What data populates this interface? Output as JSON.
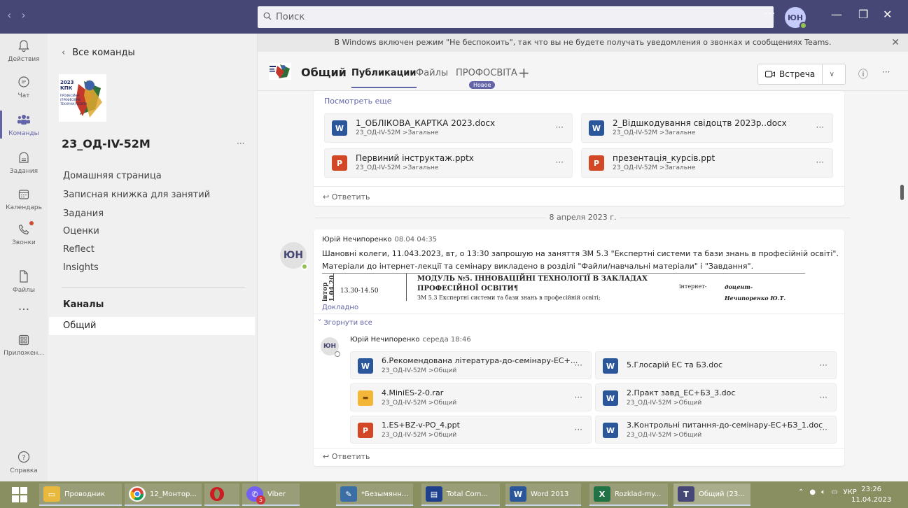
{
  "titlebar": {
    "back": "‹",
    "forward": "›",
    "search_placeholder": "Поиск",
    "more": "···",
    "avatar_initials": "ЮН",
    "minimize": "—",
    "restore": "❐",
    "close": "✕"
  },
  "rail": [
    {
      "label": "Действия",
      "icon": "bell-icon"
    },
    {
      "label": "Чат",
      "icon": "chat-icon"
    },
    {
      "label": "Команды",
      "icon": "teams-icon"
    },
    {
      "label": "Задания",
      "icon": "assignments-icon"
    },
    {
      "label": "Календарь",
      "icon": "calendar-icon"
    },
    {
      "label": "Звонки",
      "icon": "phone-icon"
    },
    {
      "label": "Файлы",
      "icon": "file-icon"
    },
    {
      "label": "···",
      "icon": "more-icon"
    },
    {
      "label": "Приложен...",
      "icon": "apps-icon"
    },
    {
      "label": "Справка",
      "icon": "help-icon"
    }
  ],
  "sidebar": {
    "back_label": "Все команды",
    "team_name": "23_ОД-IV-52M",
    "more": "···",
    "links": [
      "Домашняя страница",
      "Записная книжка для занятий",
      "Задания",
      "Оценки",
      "Reflect",
      "Insights"
    ],
    "channels_heading": "Каналы",
    "channels": [
      "Общий"
    ],
    "logo_text": "2023 КПК ПРОФЕСІЙНА (ПРОФЕСІЙНО ТЕХНІЧНА) ОСВІТА"
  },
  "main": {
    "dnd_notice": "В Windows включен режим \"Не беспокоить\", так что вы не будете получать уведомления о звонках и сообщениях Teams.",
    "channel_title": "Общий",
    "tabs": [
      "Публикации",
      "Файлы",
      "ПРОФОСВІТА"
    ],
    "new_badge": "Новое",
    "meet_label": "Встреча",
    "see_more": "Посмотреть еще",
    "reply_label": "Ответить",
    "date_separator": "8 апреля 2023 г.",
    "top_files": [
      {
        "name": "1_ОБЛІКОВА_КАРТКА 2023.docx",
        "path": "23_ОД-IV-52M >Загальне",
        "type": "word"
      },
      {
        "name": "2_Відшкодування свідоцтв 2023р..docx",
        "path": "23_ОД-IV-52M >Загальне",
        "type": "word"
      },
      {
        "name": "Первиний інструктаж.pptx",
        "path": "23_ОД-IV-52M >Загальне",
        "type": "ppt"
      },
      {
        "name": "презентація_курсів.ppt",
        "path": "23_ОД-IV-52M >Загальне",
        "type": "ppt"
      }
    ],
    "post": {
      "avatar": "ЮН",
      "author": "Юрій Нечипоренко",
      "time": "08.04 04:35",
      "line1": "Шановні колеги, 11.043.2023, вт, о 13:30 запрошую на заняття ЗМ 5.3 \"Експертні системи та бази знань в професійній освіті\".",
      "line2": "Матеріали до інтернет-лекції та семінару викладено в розділі \"Файли/навчальні матеріали\" і \"Завдання\".",
      "doc_date": "івтор 1.04.20",
      "doc_time": "13.30-14.50",
      "doc_heading1": "МОДУЛЬ №5. ІННОВАЦІЙНІ ТЕХНОЛОГІЇ В ЗАКЛАДАХ",
      "doc_heading2": "ПРОФЕСІЙНОЇ ОСВІТИ¶",
      "doc_sub": "ЗМ 5.3 Експертні системи та бази знань в професійній освіті;",
      "doc_col1": "інтернет-",
      "doc_col2": "доцент-",
      "doc_col3": "Нечипоренко Ю.Т.",
      "details": "Докладно",
      "collapse": "Згорнути все"
    },
    "reply_post": {
      "avatar": "ЮН",
      "author": "Юрій Нечипоренко",
      "time": "середа 18:46",
      "files": [
        {
          "name": "6.Рекомендована література-до-семінару-ЕС+...",
          "path": "23_ОД-IV-52M >Общий",
          "type": "word"
        },
        {
          "name": "5.Глосарій ЕС та БЗ.doc",
          "path": "",
          "type": "word"
        },
        {
          "name": "4.MiniES-2-0.rar",
          "path": "23_ОД-IV-52M >Общий",
          "type": "rar"
        },
        {
          "name": "2.Практ завд_ЕС+БЗ_3.doc",
          "path": "23_ОД-IV-52M >Общий",
          "type": "word"
        },
        {
          "name": "1.ES+BZ-v-PO_4.ppt",
          "path": "23_ОД-IV-52M >Общий",
          "type": "ppt"
        },
        {
          "name": "3.Контрольні питання-до-семінару-ЕС+БЗ_1.doc",
          "path": "23_ОД-IV-52M >Общий",
          "type": "word"
        }
      ]
    }
  },
  "taskbar": {
    "apps": [
      {
        "label": "Проводник",
        "icon": "folder-icon"
      },
      {
        "label": "12_Монтор...",
        "icon": "chrome-icon"
      },
      {
        "label": "",
        "icon": "opera-icon"
      },
      {
        "label": "Viber",
        "icon": "viber-icon",
        "badge": "5"
      },
      {
        "label": "*Безымянн...",
        "icon": "paint-icon"
      },
      {
        "label": "Total Com...",
        "icon": "totalcmd-icon"
      },
      {
        "label": "Word 2013",
        "icon": "word-icon"
      },
      {
        "label": "Rozklad-my...",
        "icon": "excel-icon"
      },
      {
        "label": "Общий (23...",
        "icon": "teams-icon"
      }
    ],
    "lang": "УКР",
    "time": "23:26",
    "date": "11.04.2023"
  },
  "colors": {
    "accent": "#6264a7",
    "titlebar": "#464775",
    "word": "#2b579a",
    "ppt": "#d24726",
    "online": "#92c353"
  }
}
